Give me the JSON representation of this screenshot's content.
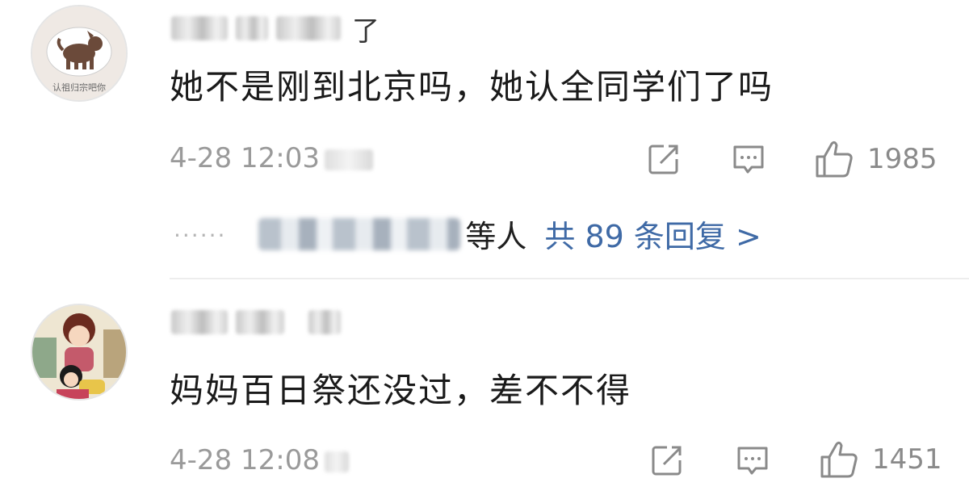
{
  "comments": [
    {
      "username_tail": "了",
      "text": "她不是刚到北京吗，她认全同学们了吗",
      "time": "4-28 12:03",
      "likes": "1985",
      "avatar": {
        "icon": "dog-cartoon-icon",
        "caption": "认祖归宗吧你"
      },
      "replies": {
        "suffix": "等人",
        "count_text": "共 89 条回复 >"
      }
    },
    {
      "username_tail": "",
      "text": "妈妈百日祭还没过，差不不得",
      "time": "4-28 12:08",
      "likes": "1451",
      "avatar": {
        "icon": "maruko-cartoon-icon"
      }
    }
  ],
  "icons": {
    "share": "share-icon",
    "comment": "comment-icon",
    "like": "thumbs-up-icon"
  },
  "colors": {
    "link": "#3f6aa6",
    "meta": "#9a9a9a",
    "text": "#1a1a1a"
  }
}
